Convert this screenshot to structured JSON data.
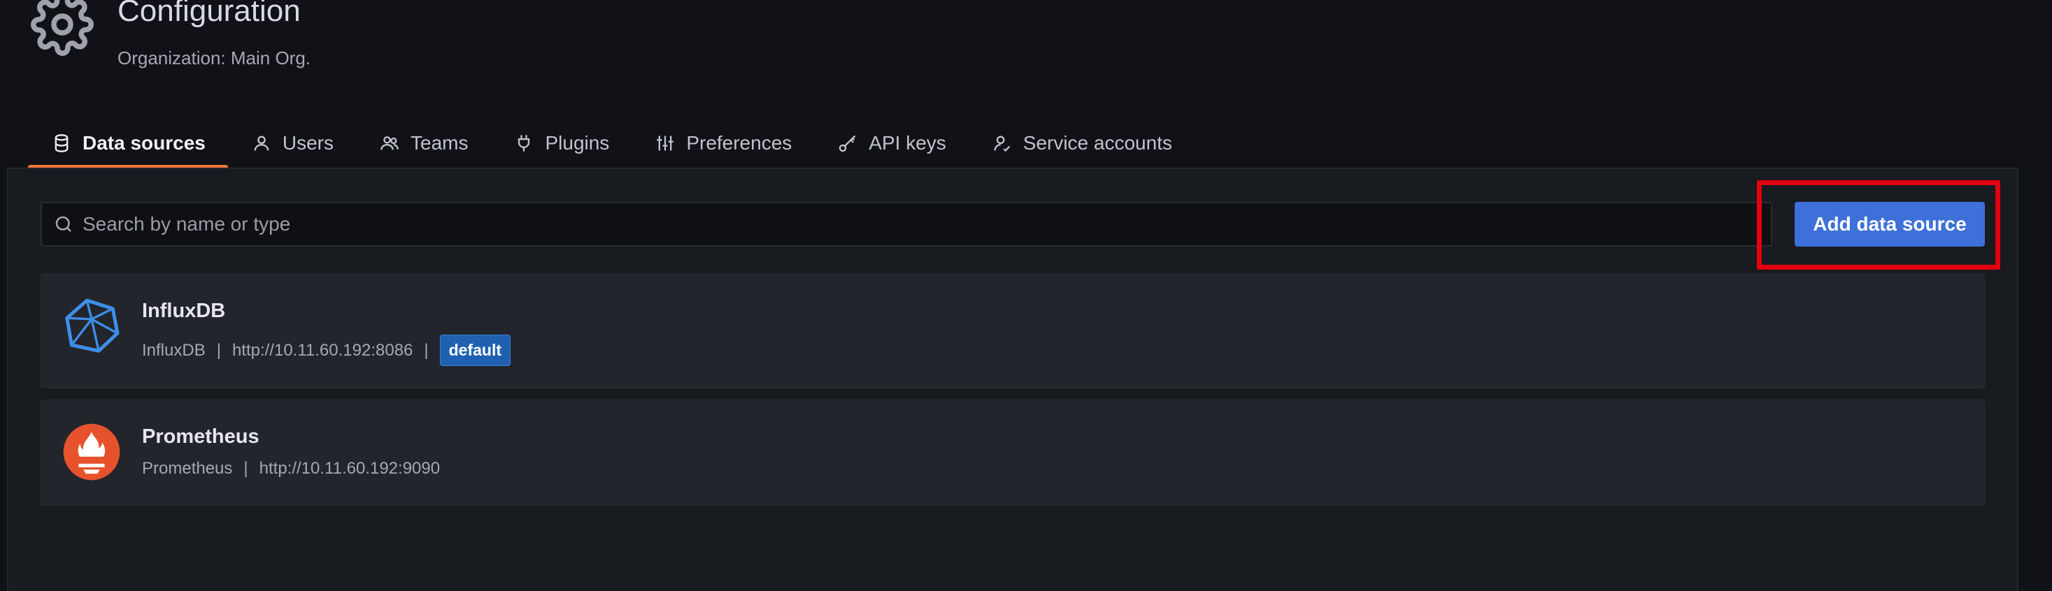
{
  "header": {
    "title": "Configuration",
    "subtitle": "Organization: Main Org.",
    "icon": "gear-icon"
  },
  "tabs": [
    {
      "label": "Data sources",
      "icon": "database-icon",
      "active": true
    },
    {
      "label": "Users",
      "icon": "user-icon",
      "active": false
    },
    {
      "label": "Teams",
      "icon": "users-icon",
      "active": false
    },
    {
      "label": "Plugins",
      "icon": "plug-icon",
      "active": false
    },
    {
      "label": "Preferences",
      "icon": "sliders-icon",
      "active": false
    },
    {
      "label": "API keys",
      "icon": "key-icon",
      "active": false
    },
    {
      "label": "Service accounts",
      "icon": "user-cog-icon",
      "active": false
    }
  ],
  "search": {
    "placeholder": "Search by name or type",
    "value": ""
  },
  "actions": {
    "add_label": "Add data source"
  },
  "datasources": [
    {
      "name": "InfluxDB",
      "type": "InfluxDB",
      "url": "http://10.11.60.192:8086",
      "badge": "default",
      "logo": "influxdb-logo"
    },
    {
      "name": "Prometheus",
      "type": "Prometheus",
      "url": "http://10.11.60.192:9090",
      "logo": "prometheus-logo"
    }
  ],
  "colors": {
    "background": "#111217",
    "accent_button": "#3d71d9",
    "highlight": "#e3000f",
    "badge": "#1f61b0",
    "tab_underline": "#f0783a"
  }
}
